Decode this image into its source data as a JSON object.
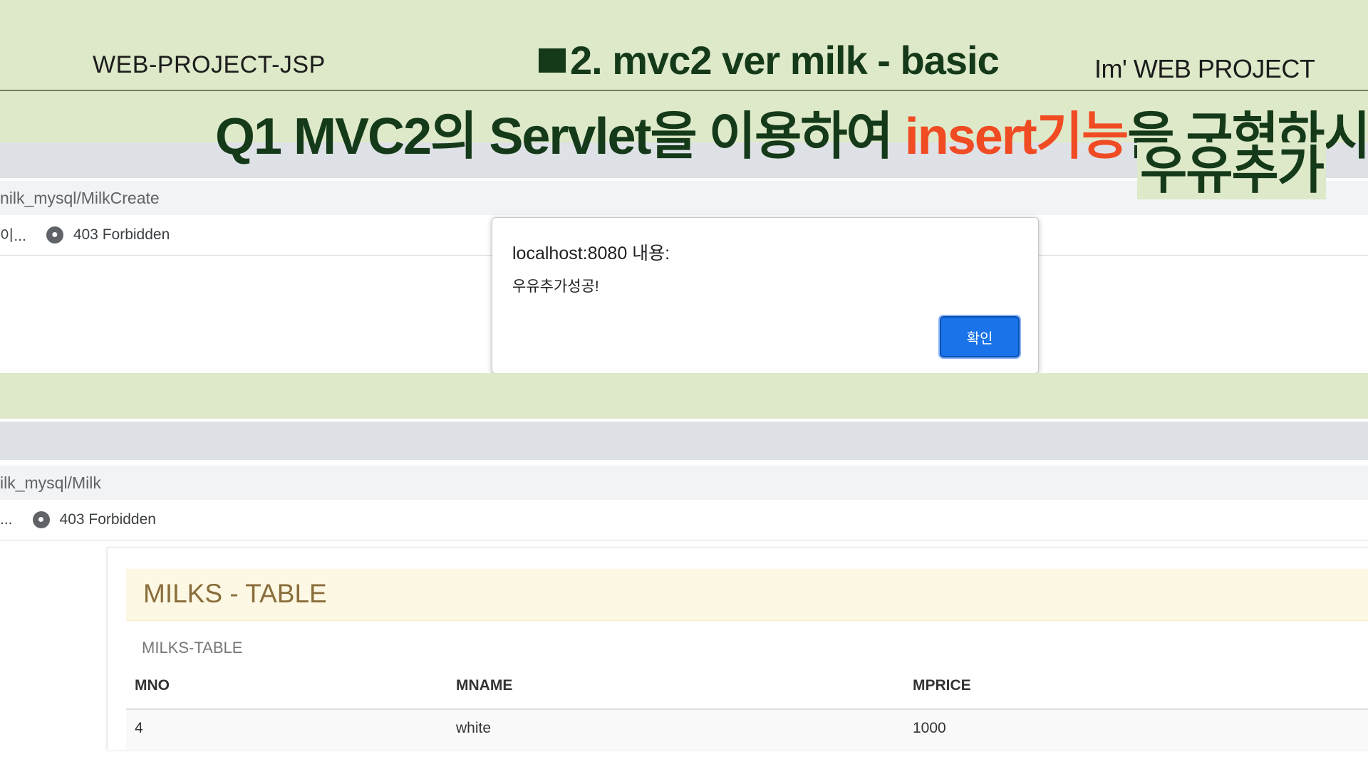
{
  "slide": {
    "header_left": "WEB-PROJECT-JSP",
    "header_center": "2. mvc2 ver  milk - basic",
    "header_right": "Im'  WEB PROJECT",
    "question_prefix": "Q1  MVC2의 Servlet을 이용하여 ",
    "question_highlight": "insert기능",
    "question_suffix": "을 구현하시오.",
    "question_sub": "우유추가",
    "highlight_color": "#f04b23",
    "title_color": "#153a1a",
    "background_color": "#dde9c9"
  },
  "browser_create": {
    "address": "nilk_mysql/MilkCreate",
    "bookmark_truncated": "이...",
    "bookmark_label": "403 Forbidden"
  },
  "alert": {
    "title": "localhost:8080 내용:",
    "message": "우유추가성공!",
    "confirm_label": "확인"
  },
  "browser_list": {
    "address": "ilk_mysql/Milk",
    "bookmark_truncated": "...",
    "bookmark_label": "403 Forbidden"
  },
  "milks_panel": {
    "title": "MILKS - TABLE",
    "caption": "MILKS-TABLE",
    "columns": [
      "MNO",
      "MNAME",
      "MPRICE"
    ],
    "rows": [
      [
        "4",
        "white",
        "1000"
      ]
    ]
  }
}
